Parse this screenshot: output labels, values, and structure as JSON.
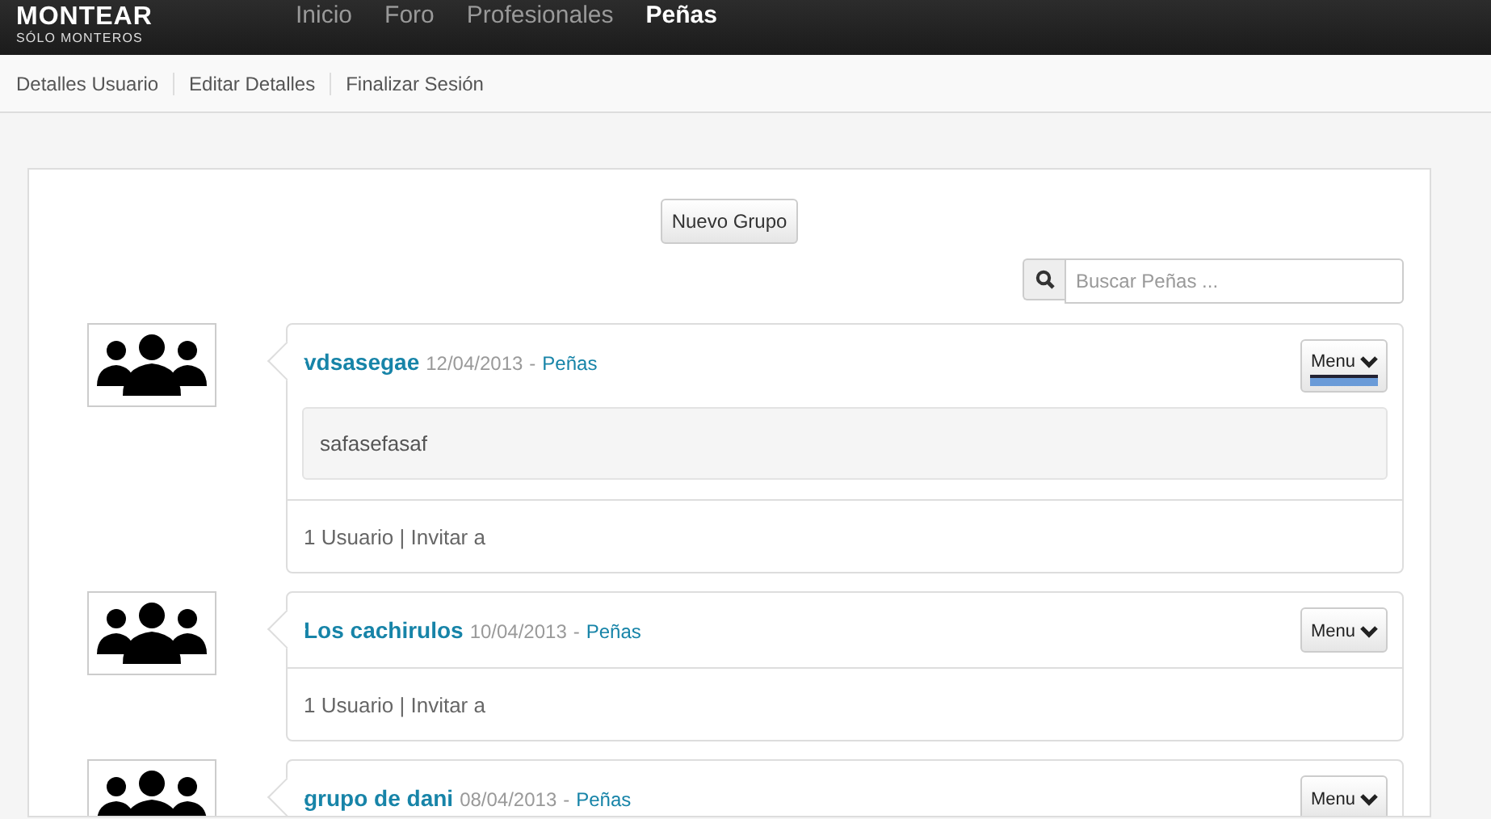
{
  "brand": {
    "name": "MONTEAR",
    "tagline": "SÓLO MONTEROS"
  },
  "nav": [
    {
      "label": "Inicio",
      "selected": false
    },
    {
      "label": "Foro",
      "selected": false
    },
    {
      "label": "Profesionales",
      "selected": false
    },
    {
      "label": "Peñas",
      "selected": true
    }
  ],
  "subnav": [
    "Detalles Usuario",
    "Editar Detalles",
    "Finalizar Sesión"
  ],
  "new_group_button": "Nuevo Grupo",
  "search": {
    "placeholder": "Buscar Peñas ..."
  },
  "groups": [
    {
      "name": "vdsasegae",
      "date": "12/04/2013",
      "separator": "-",
      "category": "Peñas",
      "menu": "Menu",
      "menu_focused": true,
      "description": "safasefasaf",
      "footer": "1 Usuario | Invitar a"
    },
    {
      "name": "Los cachirulos",
      "date": "10/04/2013",
      "separator": "-",
      "category": "Peñas",
      "menu": "Menu",
      "menu_focused": false,
      "footer": "1 Usuario | Invitar a"
    },
    {
      "name": "grupo de dani",
      "date": "08/04/2013",
      "separator": "-",
      "category": "Peñas",
      "menu": "Menu",
      "menu_focused": false
    }
  ]
}
